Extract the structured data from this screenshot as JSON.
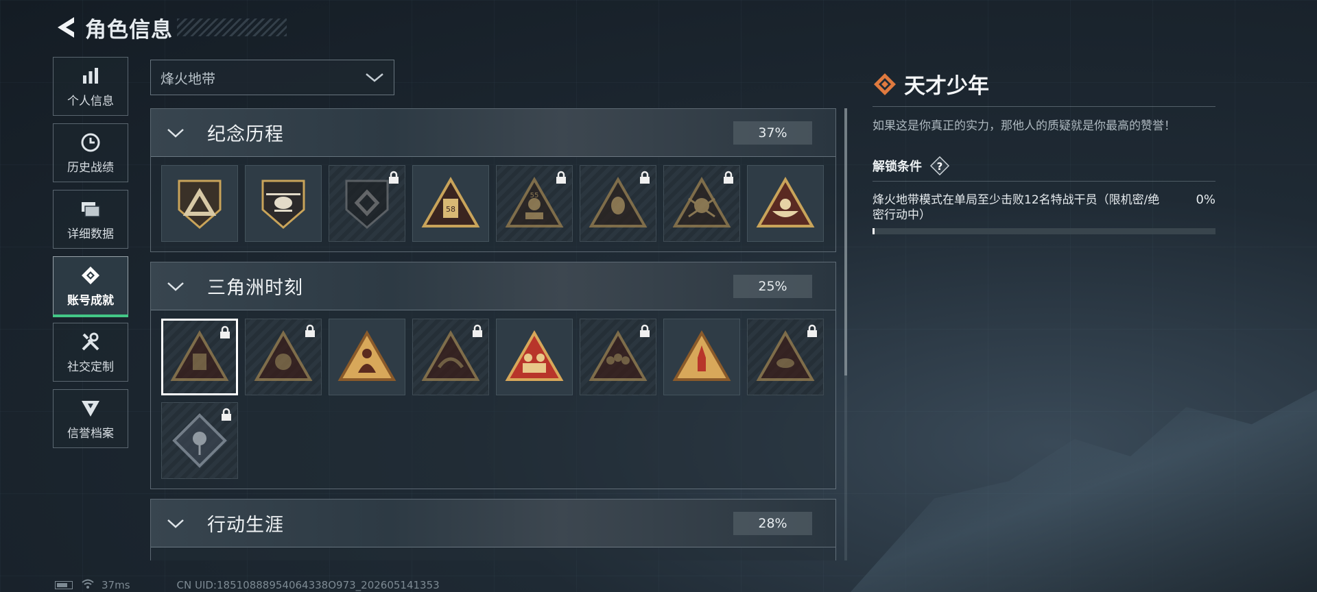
{
  "header": {
    "title": "角色信息"
  },
  "nav": [
    {
      "label": "个人信息",
      "icon": "bar-chart-icon"
    },
    {
      "label": "历史战绩",
      "icon": "clock-icon"
    },
    {
      "label": "详细数据",
      "icon": "folders-icon"
    },
    {
      "label": "账号成就",
      "icon": "achievement-icon",
      "active": true
    },
    {
      "label": "社交定制",
      "icon": "tools-icon"
    },
    {
      "label": "信誉档案",
      "icon": "shield-icon"
    }
  ],
  "mode_select": {
    "value": "烽火地带"
  },
  "categories": [
    {
      "name": "纪念历程",
      "percent": "37%",
      "badges": [
        {
          "icon": "shield-triangle-badge",
          "locked": false
        },
        {
          "icon": "helicopter-shield-badge",
          "locked": false
        },
        {
          "icon": "dark-shield-badge",
          "locked": true
        },
        {
          "icon": "triangle-card-badge",
          "locked": false,
          "text": "58"
        },
        {
          "icon": "triangle-soldier-badge",
          "locked": true,
          "text": "55"
        },
        {
          "icon": "triangle-head-badge",
          "locked": true
        },
        {
          "icon": "triangle-skull-badge",
          "locked": true
        },
        {
          "icon": "triangle-bowl-badge",
          "locked": false
        }
      ]
    },
    {
      "name": "三角洲时刻",
      "percent": "25%",
      "badges": [
        {
          "icon": "triangle-box-badge",
          "locked": true,
          "selected": true
        },
        {
          "icon": "triangle-bear-badge",
          "locked": true
        },
        {
          "icon": "triangle-figure-badge",
          "locked": false
        },
        {
          "icon": "triangle-hands-badge",
          "locked": true
        },
        {
          "icon": "triangle-group-badge",
          "locked": false
        },
        {
          "icon": "triangle-crowd-badge",
          "locked": true
        },
        {
          "icon": "triangle-rocket-badge",
          "locked": false
        },
        {
          "icon": "triangle-fish-badge",
          "locked": true
        },
        {
          "icon": "diamond-rose-badge",
          "locked": true
        }
      ]
    },
    {
      "name": "行动生涯",
      "percent": "28%",
      "badges": []
    }
  ],
  "detail": {
    "title": "天才少年",
    "title_icon": "diamond-emblem-icon",
    "description": "如果这是你真正的实力，那他人的质疑就是你最高的赞誉！",
    "unlock_label": "解锁条件",
    "help_icon": "question-icon",
    "condition": "烽火地带模式在单局至少击败12名特战干员（限机密/绝密行动中）",
    "condition_percent": "0%",
    "progress": 0
  },
  "status": {
    "latency": "37ms",
    "uid": "CN UID:18510888954064338O973_202605141353"
  },
  "colors": {
    "accent_green": "#43c887",
    "badge_gold": "#c9a45a",
    "emblem_orange": "#e07a3f"
  }
}
